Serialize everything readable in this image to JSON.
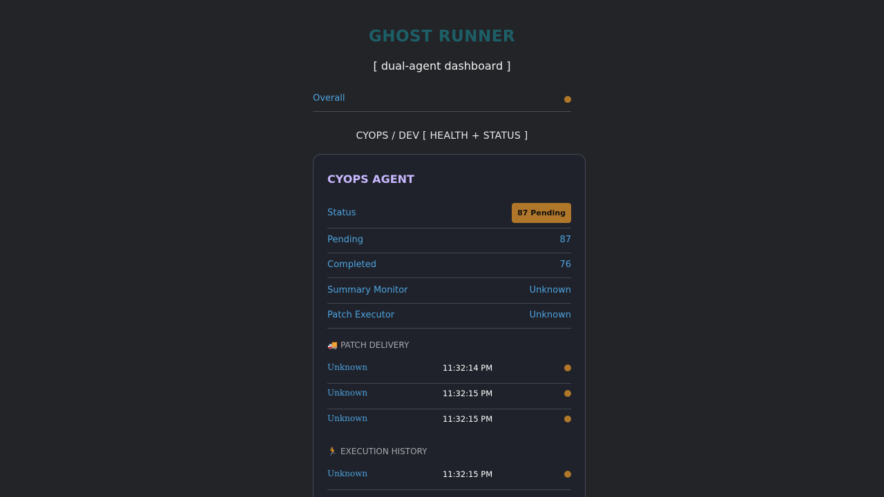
{
  "app": {
    "title": "GHOST RUNNER",
    "subtitle": "[ dual-agent dashboard ]"
  },
  "overall": {
    "label": "Overall",
    "status_color": "#b0772a"
  },
  "section": {
    "title": "CYOPS / DEV [ HEALTH + STATUS ]"
  },
  "card": {
    "title": "CYOPS AGENT",
    "status": {
      "label": "Status",
      "badge": "87 Pending",
      "badge_color": "#b0772a"
    },
    "rows": [
      {
        "label": "Pending",
        "value": "87"
      },
      {
        "label": "Completed",
        "value": "76"
      },
      {
        "label": "Summary Monitor",
        "value": "Unknown"
      },
      {
        "label": "Patch Executor",
        "value": "Unknown"
      }
    ],
    "patch_delivery": {
      "heading": "PATCH DELIVERY",
      "icon": "delivery-truck-icon",
      "items": [
        {
          "name": "Unknown",
          "time": "11:32:14 PM",
          "status_color": "#b0772a"
        },
        {
          "name": "Unknown",
          "time": "11:32:15 PM",
          "status_color": "#b0772a"
        },
        {
          "name": "Unknown",
          "time": "11:32:15 PM",
          "status_color": "#b0772a"
        }
      ]
    },
    "execution_history": {
      "heading": "EXECUTION HISTORY",
      "icon": "runner-icon",
      "items": [
        {
          "name": "Unknown",
          "time": "11:32:15 PM",
          "status_color": "#b0772a"
        }
      ]
    }
  },
  "colors": {
    "background": "#232428",
    "accent_blue": "#4da3e0",
    "title_teal": "#1d5f67",
    "card_title_purple": "#c9b8ff",
    "pending_amber": "#b0772a"
  }
}
